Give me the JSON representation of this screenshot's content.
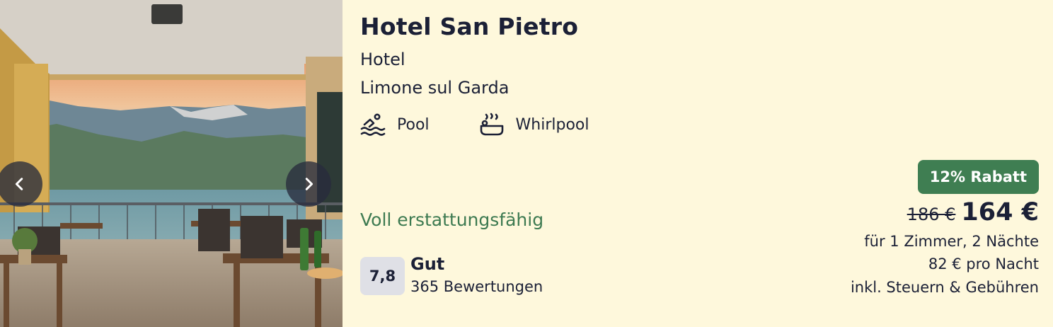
{
  "hotel": {
    "name": "Hotel San Pietro",
    "type": "Hotel",
    "location": "Limone sul Garda"
  },
  "amenities": [
    {
      "label": "Pool",
      "icon": "pool-icon"
    },
    {
      "label": "Whirlpool",
      "icon": "whirlpool-icon"
    }
  ],
  "cancellation": "Voll erstattungsfähig",
  "rating": {
    "score": "7,8",
    "label": "Gut",
    "count": "365 Bewertungen"
  },
  "pricing": {
    "discount_badge": "12% Rabatt",
    "old_price": "186 €",
    "new_price": "164 €",
    "stay": "für 1 Zimmer, 2 Nächte",
    "per_night": "82 € pro Nacht",
    "taxes": "inkl. Steuern & Gebühren"
  },
  "gallery": {
    "prev_icon": "chevron-left-icon",
    "next_icon": "chevron-right-icon"
  },
  "colors": {
    "background": "#fef8dc",
    "text": "#1b2036",
    "accent_green": "#3d7a51",
    "badge_green": "#3f7e52",
    "score_bg": "#dfe0e6"
  }
}
